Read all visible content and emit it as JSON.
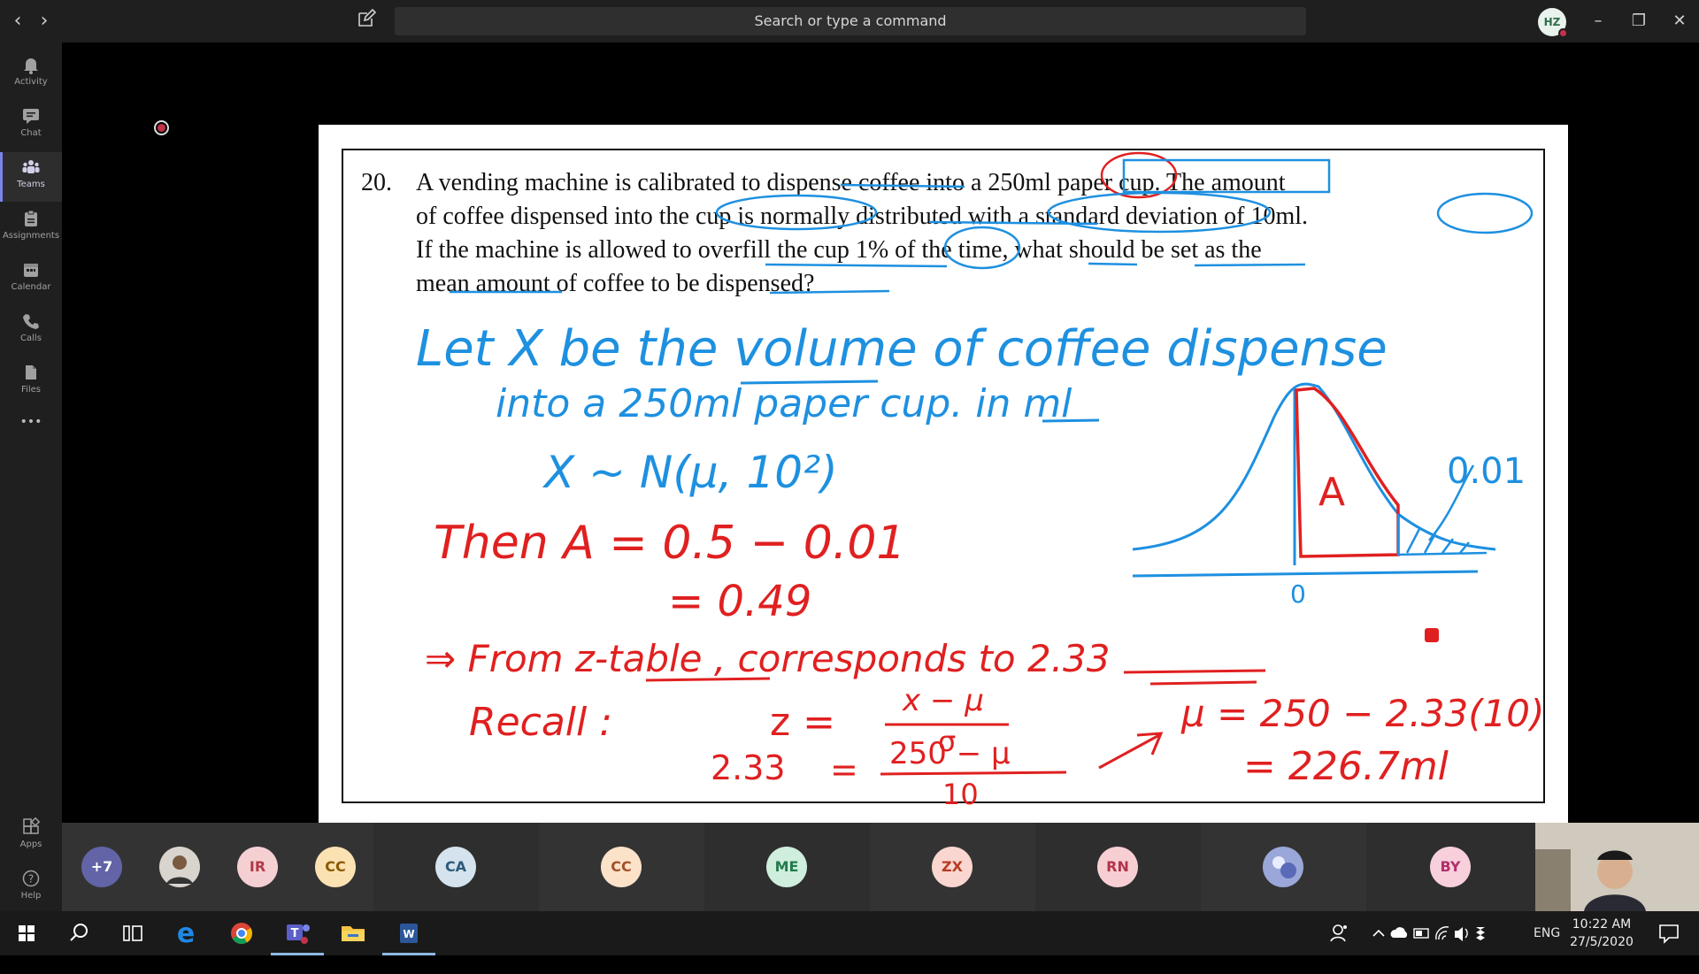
{
  "topbar": {
    "back": "‹",
    "forward": "›",
    "search_placeholder": "Search or type a command",
    "user_initials": "HZ",
    "minimize": "–",
    "restore": "❐",
    "close": "✕"
  },
  "rail": {
    "items": [
      {
        "label": "Activity",
        "icon": "bell-icon"
      },
      {
        "label": "Chat",
        "icon": "chat-icon"
      },
      {
        "label": "Teams",
        "icon": "teams-icon",
        "active": true
      },
      {
        "label": "Assignments",
        "icon": "assignments-icon"
      },
      {
        "label": "Calendar",
        "icon": "calendar-icon"
      },
      {
        "label": "Calls",
        "icon": "phone-icon"
      },
      {
        "label": "Files",
        "icon": "files-icon"
      }
    ],
    "more": "•••",
    "apps": "Apps",
    "help": "Help"
  },
  "slide": {
    "problem_number": "20.",
    "problem_lines": [
      "A vending machine is calibrated to dispense coffee into a 250ml paper cup.  The amount",
      "of coffee dispensed into the cup is normally distributed with a standard deviation of 10ml.",
      "If the machine is allowed to overfill the cup 1% of the time, what should be set as the",
      "mean amount of coffee to be dispensed?"
    ],
    "handwriting": {
      "line1": "Let X be the volume of coffee dispense",
      "line2": "into a 250ml paper cup. in ml",
      "dist": "X ~ N(μ, 10²)",
      "then": "Then A = 0.5 − 0.01",
      "then2": "= 0.49",
      "from": "⇒ From z-table , corresponds to 2.33",
      "recall": "Recall :",
      "zformula": "z =",
      "zfrac_num": "x − μ",
      "zfrac_den": "σ",
      "eq_left": "2.33",
      "eq_sign": "=",
      "eq_num": "250 − μ",
      "eq_den": "10",
      "mu_result": "μ = 250 − 2.33(10)",
      "mu_final": "= 226.7ml",
      "region_label": "A",
      "tail_label": "0.01",
      "zero_label": "0"
    }
  },
  "participants": [
    {
      "initials": "+7",
      "bg": "#6264a7",
      "fg": "#ffffff"
    },
    {
      "initials": "",
      "photo": true
    },
    {
      "initials": "IR",
      "bg": "#f5d0d3",
      "fg": "#b13a47"
    },
    {
      "initials": "CC",
      "bg": "#fbe2b3",
      "fg": "#8a5a00"
    },
    {
      "initials": "CA",
      "bg": "#d4e3ee",
      "fg": "#2e5a7a"
    },
    {
      "initials": "CC",
      "bg": "#fbe2c8",
      "fg": "#a0522d"
    },
    {
      "initials": "ME",
      "bg": "#cfeedd",
      "fg": "#237b4b"
    },
    {
      "initials": "ZX",
      "bg": "#f9d6cf",
      "fg": "#b43c25"
    },
    {
      "initials": "RN",
      "bg": "#f7cfd2",
      "fg": "#b1354a"
    },
    {
      "initials": "",
      "photo": true
    },
    {
      "initials": "BY",
      "bg": "#f7d0dc",
      "fg": "#b0306a"
    }
  ],
  "taskbar": {
    "lang": "ENG",
    "time": "10:22 AM",
    "date": "27/5/2020"
  }
}
